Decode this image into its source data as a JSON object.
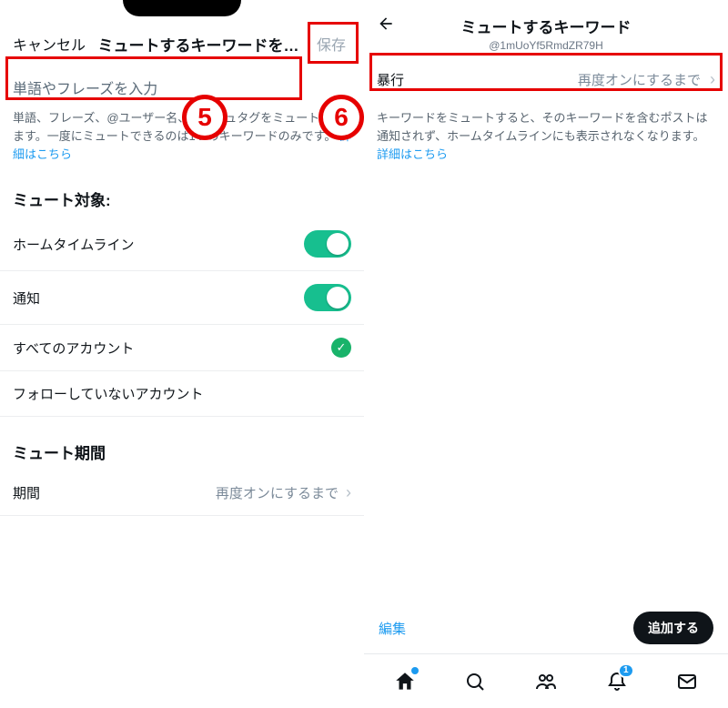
{
  "left": {
    "header": {
      "cancel": "キャンセル",
      "title": "ミュートするキーワードを…",
      "save": "保存"
    },
    "input_placeholder": "単語やフレーズを入力",
    "help_text": "単語、フレーズ、@ユーザー名、ハッシュタグをミュートできます。一度にミュートできるのは1つのキーワードのみです。",
    "help_link": "詳細はこちら",
    "section_target": "ミュート対象:",
    "rows": {
      "home_timeline": "ホームタイムライン",
      "notifications": "通知",
      "all_accounts": "すべてのアカウント",
      "not_following": "フォローしていないアカウント"
    },
    "section_period": "ミュート期間",
    "period_label": "期間",
    "period_value": "再度オンにするまで"
  },
  "right": {
    "header": {
      "title": "ミュートするキーワード",
      "subtitle": "@1mUoYf5RmdZR79H"
    },
    "item": {
      "label": "暴行",
      "duration": "再度オンにするまで"
    },
    "help_text": "キーワードをミュートすると、そのキーワードを含むポストは通知されず、ホームタイムラインにも表示されなくなります。",
    "help_link": "詳細はこちら",
    "toolbar": {
      "edit": "編集",
      "add": "追加する"
    },
    "tabbar": {
      "notif_badge": "1"
    }
  },
  "annotations": {
    "five": "5",
    "six": "6"
  }
}
